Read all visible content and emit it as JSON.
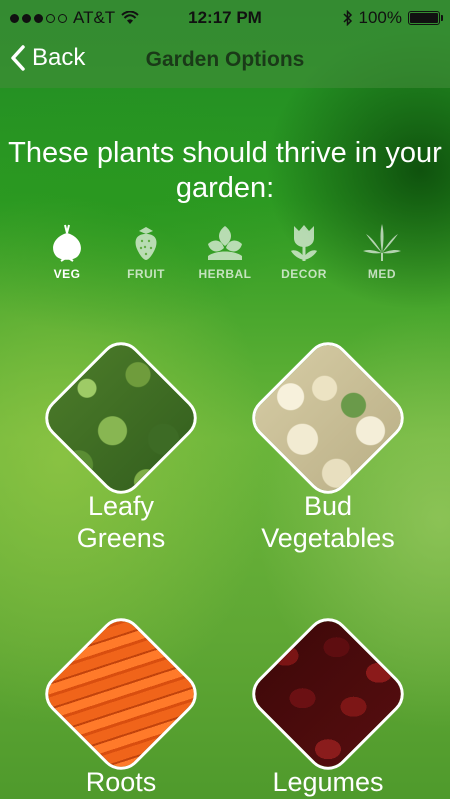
{
  "status": {
    "carrier": "AT&T",
    "time": "12:17 PM",
    "battery": "100%"
  },
  "nav": {
    "back_label": "Back",
    "title": "Garden Options"
  },
  "headline": "These plants should thrive in your garden:",
  "categories": [
    {
      "label": "VEG",
      "icon": "onion-icon",
      "active": true
    },
    {
      "label": "FRUIT",
      "icon": "strawberry-icon",
      "active": false
    },
    {
      "label": "HERBAL",
      "icon": "leaf-icon",
      "active": false
    },
    {
      "label": "DECOR",
      "icon": "tulip-icon",
      "active": false
    },
    {
      "label": "MED",
      "icon": "cannabis-leaf-icon",
      "active": false
    }
  ],
  "cards": [
    {
      "line1": "Leafy",
      "line2": "Greens",
      "image": "kale"
    },
    {
      "line1": "Bud",
      "line2": "Vegetables",
      "image": "cauliflower"
    },
    {
      "line1": "Roots",
      "line2": "",
      "image": "carrots"
    },
    {
      "line1": "Legumes",
      "line2": "",
      "image": "kidney-beans"
    }
  ]
}
